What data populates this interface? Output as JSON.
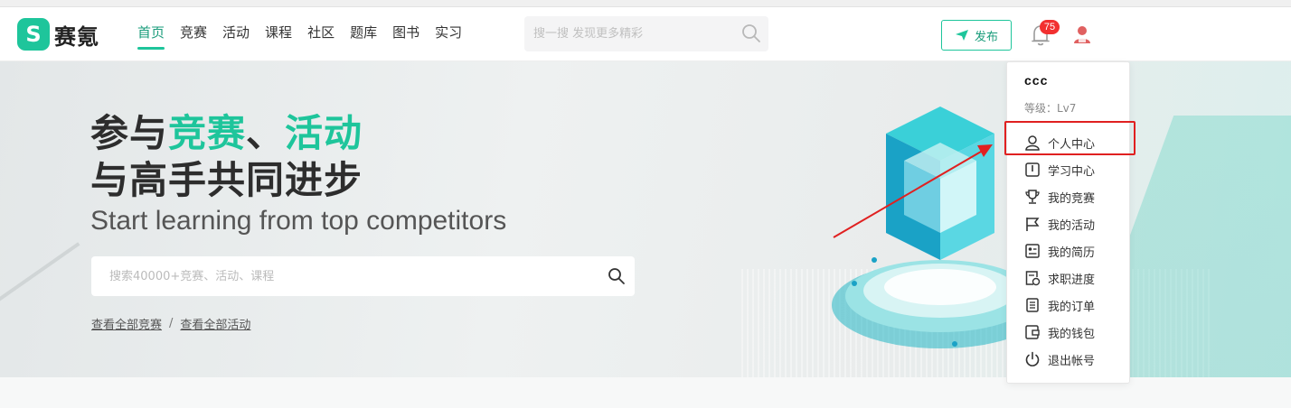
{
  "brand": {
    "name": "赛氪",
    "mark": "S",
    "color": "#1ec59b"
  },
  "nav": {
    "items": [
      {
        "label": "首页",
        "active": true
      },
      {
        "label": "竞赛"
      },
      {
        "label": "活动"
      },
      {
        "label": "课程"
      },
      {
        "label": "社区"
      },
      {
        "label": "题库"
      },
      {
        "label": "图书"
      },
      {
        "label": "实习"
      }
    ]
  },
  "search": {
    "placeholder": "搜一搜 发现更多精彩"
  },
  "header": {
    "publish_label": "发布",
    "notification_count": "75",
    "icons": [
      "paper-plane-icon",
      "bell-icon",
      "user-avatar-icon"
    ]
  },
  "hero": {
    "title_line1_a": "参与",
    "title_line1_b": "竞赛",
    "title_line1_c": "、",
    "title_line1_d": "活动",
    "title_line2": "与高手共同进步",
    "subtitle": "Start learning from top competitors",
    "search_placeholder": "搜索40000+竞赛、活动、课程",
    "link_competitions": "查看全部竞赛",
    "link_separator": "/",
    "link_activities": "查看全部活动"
  },
  "user_menu": {
    "username": "ccc",
    "level": "等级：Lv7",
    "items": [
      {
        "label": "个人中心",
        "icon": "user-icon"
      },
      {
        "label": "学习中心",
        "icon": "book-icon"
      },
      {
        "label": "我的竞赛",
        "icon": "trophy-icon"
      },
      {
        "label": "我的活动",
        "icon": "flag-icon"
      },
      {
        "label": "我的简历",
        "icon": "resume-icon"
      },
      {
        "label": "求职进度",
        "icon": "progress-doc-icon"
      },
      {
        "label": "我的订单",
        "icon": "order-icon"
      },
      {
        "label": "我的钱包",
        "icon": "wallet-icon"
      },
      {
        "label": "退出帐号",
        "icon": "power-icon"
      }
    ],
    "highlighted_item": "个人中心",
    "highlight_color": "#e02020"
  }
}
